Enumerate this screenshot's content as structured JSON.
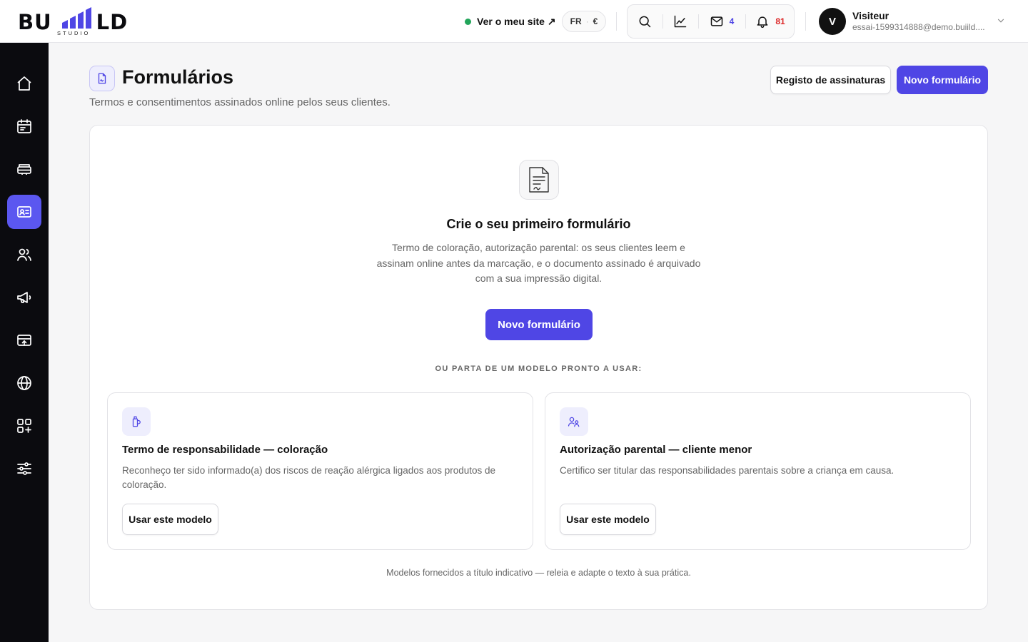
{
  "brand": {
    "name_left": "BU",
    "name_right": "LD",
    "subline": "STUDIO",
    "accent": "#4f46e5"
  },
  "header": {
    "site_link": "Ver o meu site ↗",
    "lang": "FR",
    "currency": "€",
    "messages_count": "4",
    "notifications_count": "81",
    "user": {
      "initial": "V",
      "name": "Visiteur",
      "email": "essai-1599314888@demo.buiild...."
    }
  },
  "sidebar": {
    "items": [
      {
        "name": "home",
        "icon": "home-icon"
      },
      {
        "name": "calendar",
        "icon": "calendar-icon"
      },
      {
        "name": "services",
        "icon": "stack-icon"
      },
      {
        "name": "forms",
        "icon": "id-card-icon",
        "active": true
      },
      {
        "name": "clients",
        "icon": "users-icon"
      },
      {
        "name": "marketing",
        "icon": "megaphone-icon"
      },
      {
        "name": "payments",
        "icon": "card-icon"
      },
      {
        "name": "website",
        "icon": "globe-icon"
      },
      {
        "name": "apps",
        "icon": "apps-add-icon"
      },
      {
        "name": "settings",
        "icon": "sliders-icon"
      }
    ]
  },
  "page": {
    "title": "Formulários",
    "subtitle": "Termos e consentimentos assinados online pelos seus clientes.",
    "log_button": "Registo de assinaturas",
    "new_button": "Novo formulário"
  },
  "empty_state": {
    "title": "Crie o seu primeiro formulário",
    "description": "Termo de coloração, autorização parental: os seus clientes leem e assinam online antes da marcação, e o documento assinado é arquivado com a sua impressão digital.",
    "button": "Novo formulário",
    "or_label": "OU PARTA DE UM MODELO PRONTO A USAR:"
  },
  "templates": [
    {
      "icon": "dye-bottle-icon",
      "title": "Termo de responsabilidade — coloração",
      "description": "Reconheço ter sido informado(a) dos riscos de reação alérgica ligados aos produtos de coloração.",
      "button": "Usar este modelo"
    },
    {
      "icon": "parent-child-icon",
      "title": "Autorização parental — cliente menor",
      "description": "Certifico ser titular das responsabilidades parentais sobre a criança em causa.",
      "button": "Usar este modelo"
    }
  ],
  "footnote": "Modelos fornecidos a título indicativo — releia e adapte o texto à sua prática."
}
